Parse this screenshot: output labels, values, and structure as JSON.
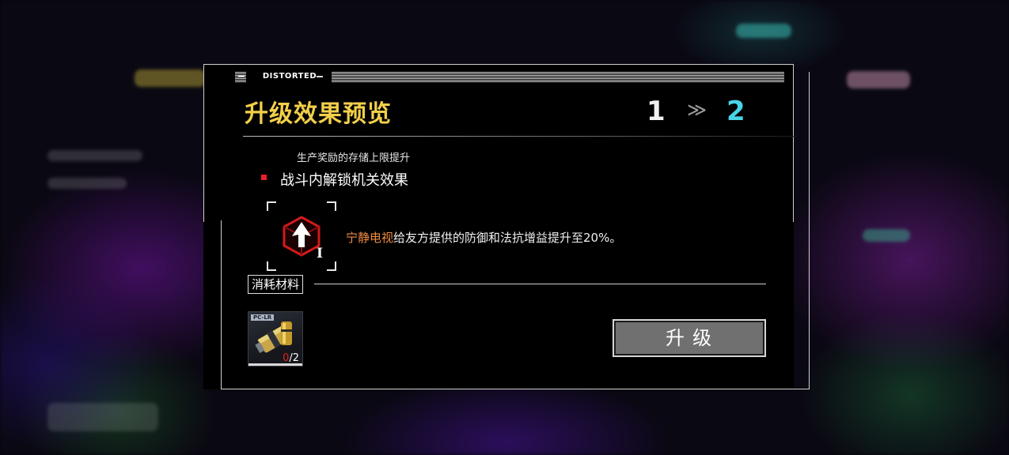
{
  "header": {
    "tag": "DISTORTED"
  },
  "dialog": {
    "title": "升级效果预览",
    "level_from": "1",
    "level_arrow": "≫",
    "level_to": "2"
  },
  "effects": {
    "sub_text": "生产奖励的存储上限提升",
    "main_label": "战斗内解锁机关效果"
  },
  "skill": {
    "icon": "arrow-cube-icon",
    "level_numeral": "I",
    "desc_highlight": "宁静电视",
    "desc_rest": "给友方提供的防御和法抗增益提升至20%。",
    "highlight_color": "#f08a3e"
  },
  "materials": {
    "label": "消耗材料",
    "items": [
      {
        "tag": "PC-LR",
        "icon": "battery-icon",
        "have": "0",
        "need": "/2"
      }
    ]
  },
  "actions": {
    "upgrade_label": "升级"
  },
  "colors": {
    "title": "#f2cf4a",
    "level_target": "#49d4e8",
    "bullet": "#e8202c",
    "button_bg": "#707070"
  }
}
